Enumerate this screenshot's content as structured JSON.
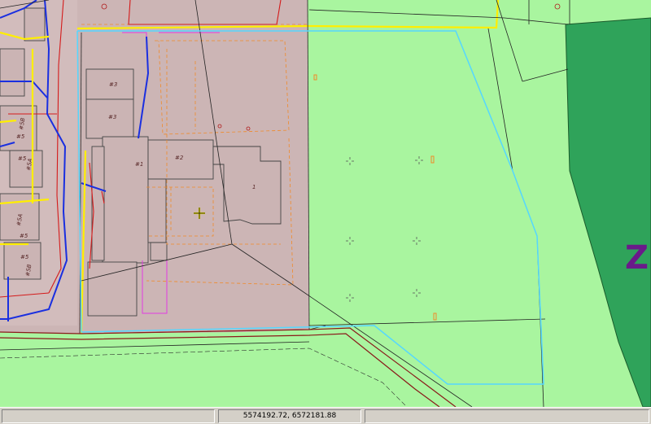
{
  "map": {
    "zone_label": "Z",
    "building_labels": {
      "b1": "#3",
      "b2": "#3",
      "b3": "#1",
      "b4": "#2",
      "b5": "1",
      "b6": "#5",
      "b7": "#5",
      "b8": "#5",
      "b9": "#5"
    },
    "side_labels": {
      "s1": "#5B",
      "s2": "#5A",
      "s3": "#5A",
      "s4": "#5B"
    },
    "colors": {
      "parcel_fill": "#ccb5b5",
      "green_fill": "#a9f59f",
      "dark_green_fill": "#2fa35a",
      "highlight_outline": "#55d7ff",
      "road_yellow": "#ffee00",
      "road_blue": "#1a2fe0",
      "line_red": "#d41a1a",
      "line_magenta": "#e23ce2",
      "line_orange": "#f08a2a",
      "zone_label_color": "#6a1a8a"
    },
    "icons": [
      "cursor-crosshair-icon",
      "survey-point-icon"
    ]
  },
  "status_bar": {
    "left": "",
    "coordinates": "5574192.72, 6572181.88",
    "right": ""
  }
}
